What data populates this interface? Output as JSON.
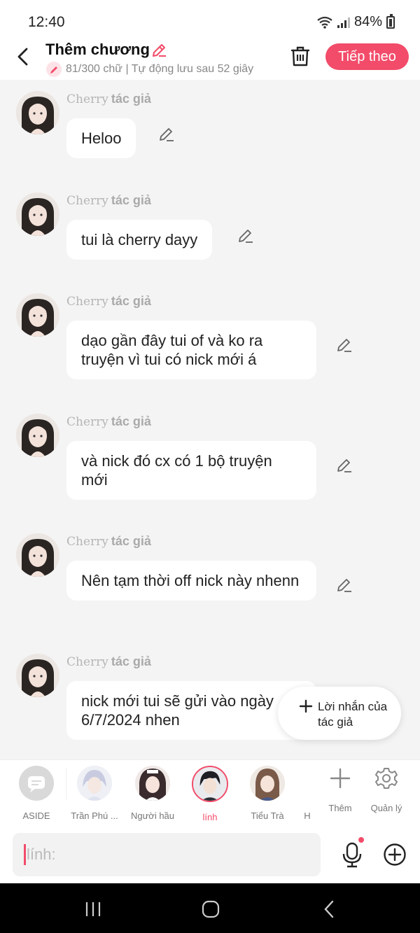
{
  "status": {
    "time": "12:40",
    "battery": "84%"
  },
  "header": {
    "title": "Thêm chương",
    "subtext": "81/300 chữ | Tự động lưu sau 52 giây",
    "next_label": "Tiếp theo"
  },
  "messages": [
    {
      "name": "Cherry",
      "role": "tác giả",
      "text": "Heloo"
    },
    {
      "name": "Cherry",
      "role": "tác giả",
      "text": "tui là cherry dayy"
    },
    {
      "name": "Cherry",
      "role": "tác giả",
      "text": "dạo gần đây tui of và ko ra truyện vì tui có nick mới á"
    },
    {
      "name": "Cherry",
      "role": "tác giả",
      "text": "và nick đó cx có 1 bộ truyện mới"
    },
    {
      "name": "Cherry",
      "role": "tác giả",
      "text": "Nên tạm thời off nick này nhenn"
    },
    {
      "name": "Cherry",
      "role": "tác giả",
      "text": "nick mới tui sẽ gửi vào ngày 6/7/2024 nhen"
    }
  ],
  "fab": {
    "label": "Lời nhắn của tác giả"
  },
  "characters": [
    {
      "label": "ASIDE"
    },
    {
      "label": "Trần Phú ..."
    },
    {
      "label": "Người hầu"
    },
    {
      "label": "lính"
    },
    {
      "label": "Tiểu Trà"
    },
    {
      "label": "H"
    }
  ],
  "tools": [
    {
      "label": "Thêm",
      "icon": "plus-icon"
    },
    {
      "label": "Quản lý",
      "icon": "gear-icon"
    }
  ],
  "input": {
    "placeholder": "lính:"
  },
  "colors": {
    "accent": "#f24c6a",
    "background": "#f4f4f4",
    "bubble": "#ffffff"
  }
}
